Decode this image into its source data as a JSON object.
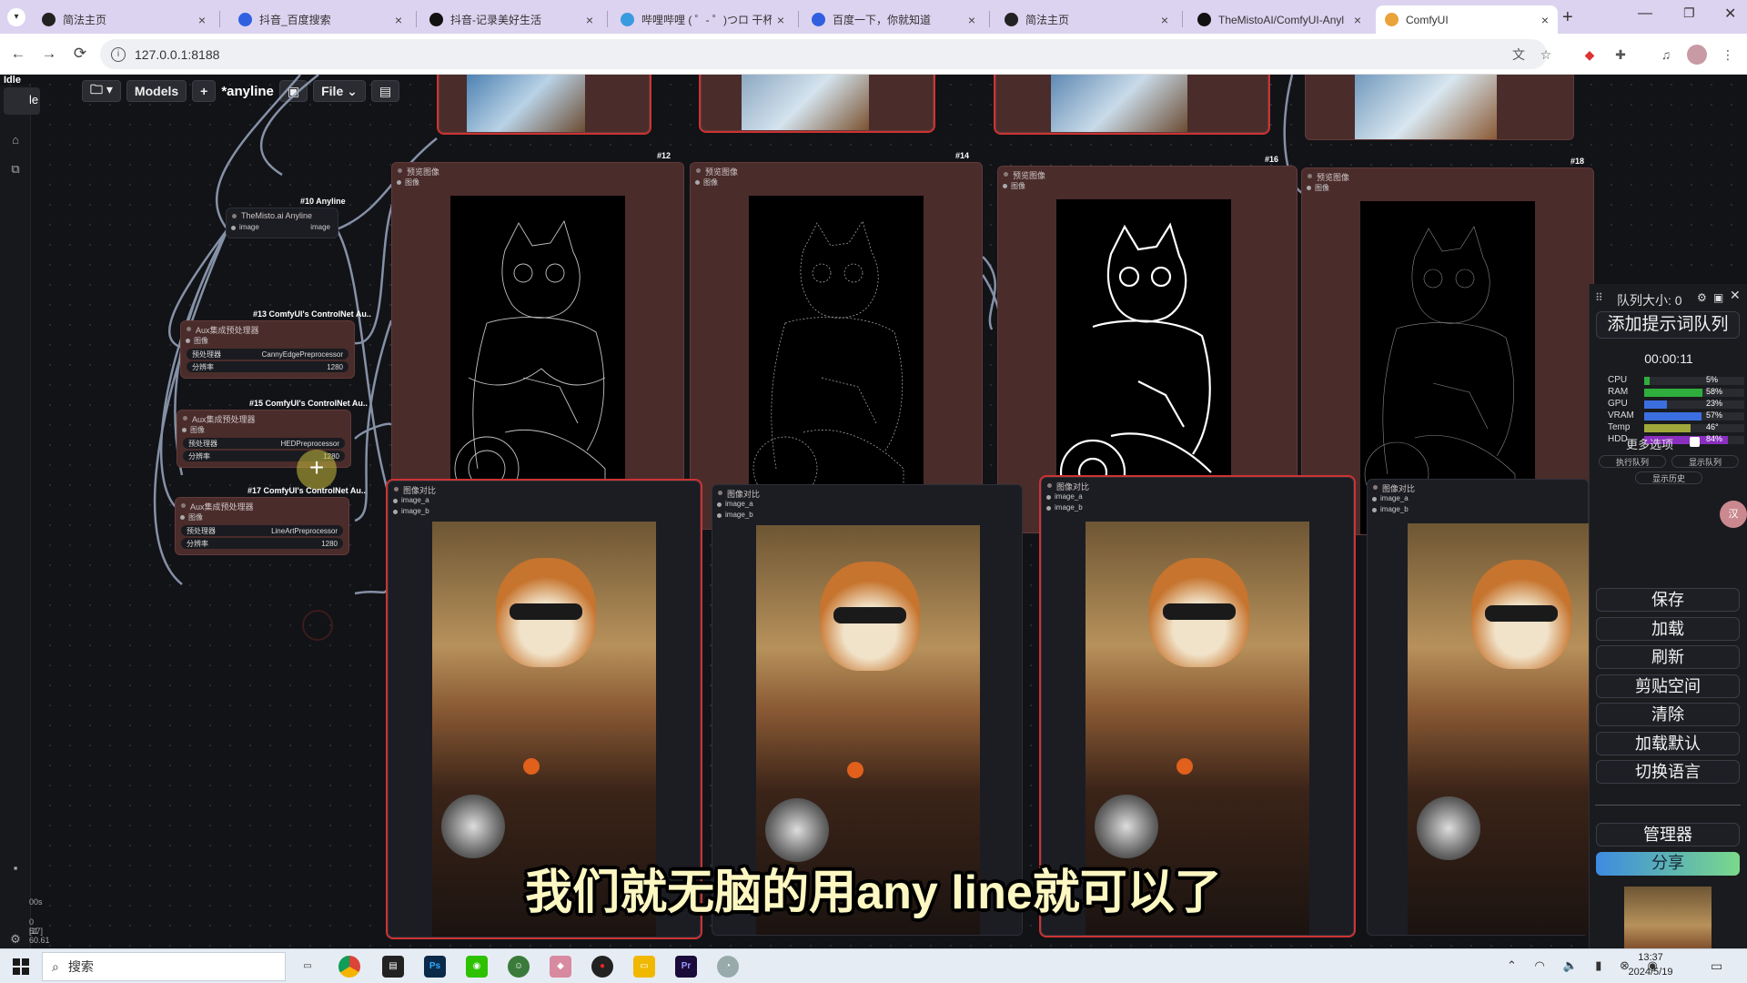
{
  "browser": {
    "tabs": [
      {
        "title": "简法主页",
        "color": "#222"
      },
      {
        "title": "抖音_百度搜索",
        "color": "#3060e0"
      },
      {
        "title": "抖音-记录美好生活",
        "color": "#111"
      },
      {
        "title": "哔哩哔哩 ( ゜- ゜)つロ 干杯~",
        "color": "#3a9ae0"
      },
      {
        "title": "百度一下，你就知道",
        "color": "#3060e0"
      },
      {
        "title": "简法主页",
        "color": "#222"
      },
      {
        "title": "TheMistoAI/ComfyUI-Anyl",
        "color": "#111"
      },
      {
        "title": "ComfyUI",
        "color": "#e8a33a"
      }
    ],
    "url": "127.0.0.1:8188"
  },
  "app": {
    "status": "Idle",
    "toolbar": {
      "models": "Models",
      "workflow_name": "*anyline",
      "file": "File"
    },
    "left_status": {
      "time": "00s",
      "line1": "0 [17]",
      "line2": "51",
      "line3": "60.61"
    }
  },
  "nodes": {
    "anyline": {
      "id": "#10 Anyline",
      "title": "TheMisto.ai Anyline",
      "in": "image",
      "out": "image"
    },
    "canny": {
      "id": "#13 ComfyUI's ControlNet Au..",
      "title": "Aux集成预处理器",
      "port": "图像",
      "w1_label": "预处理器",
      "w1_value": "CannyEdgePreprocessor",
      "w2_label": "分辨率",
      "w2_value": "1280"
    },
    "hed": {
      "id": "#15 ComfyUI's ControlNet Au..",
      "title": "Aux集成预处理器",
      "port": "图像",
      "w1_label": "预处理器",
      "w1_value": "HEDPreprocessor",
      "w2_label": "分辨率",
      "w2_value": "1280"
    },
    "lineart": {
      "id": "#17 ComfyUI's ControlNet Au..",
      "title": "Aux集成预处理器",
      "port": "图像",
      "w1_label": "预处理器",
      "w1_value": "LineArtPreprocessor",
      "w2_label": "分辨率",
      "w2_value": "1280"
    },
    "preview_title": "预览图像",
    "preview_port": "图像",
    "preview_ids": [
      "#12",
      "#14",
      "#16",
      "#18"
    ],
    "compare_title": "图像对比",
    "compare_a": "image_a",
    "compare_b": "image_b"
  },
  "queue": {
    "title": "队列大小: 0",
    "add_prompt": "添加提示词队列",
    "timer": "00:00:11",
    "stats": [
      {
        "label": "CPU",
        "value": "5%",
        "pct": 5,
        "color": "#2fae3e"
      },
      {
        "label": "RAM",
        "value": "58%",
        "pct": 58,
        "color": "#2fae3e"
      },
      {
        "label": "GPU",
        "value": "23%",
        "pct": 23,
        "color": "#3b6fe0"
      },
      {
        "label": "VRAM",
        "value": "57%",
        "pct": 57,
        "color": "#3b6fe0"
      },
      {
        "label": "Temp",
        "value": "46°",
        "pct": 46,
        "color": "#a0a83a"
      },
      {
        "label": "HDD",
        "value": "84%",
        "pct": 84,
        "color": "#8a2fc0"
      }
    ],
    "more_options": "更多选项",
    "exec_queue": "执行队列",
    "show_queue": "显示队列",
    "show_history": "显示历史",
    "buttons": [
      "保存",
      "加载",
      "刷新",
      "剪贴空间",
      "清除",
      "加载默认",
      "切换语言"
    ],
    "manager": "管理器",
    "share": "分享"
  },
  "subtitle": "我们就无脑的用any line就可以了",
  "taskbar": {
    "search": "搜索",
    "time": "13:37",
    "date": "2024/5/19"
  }
}
